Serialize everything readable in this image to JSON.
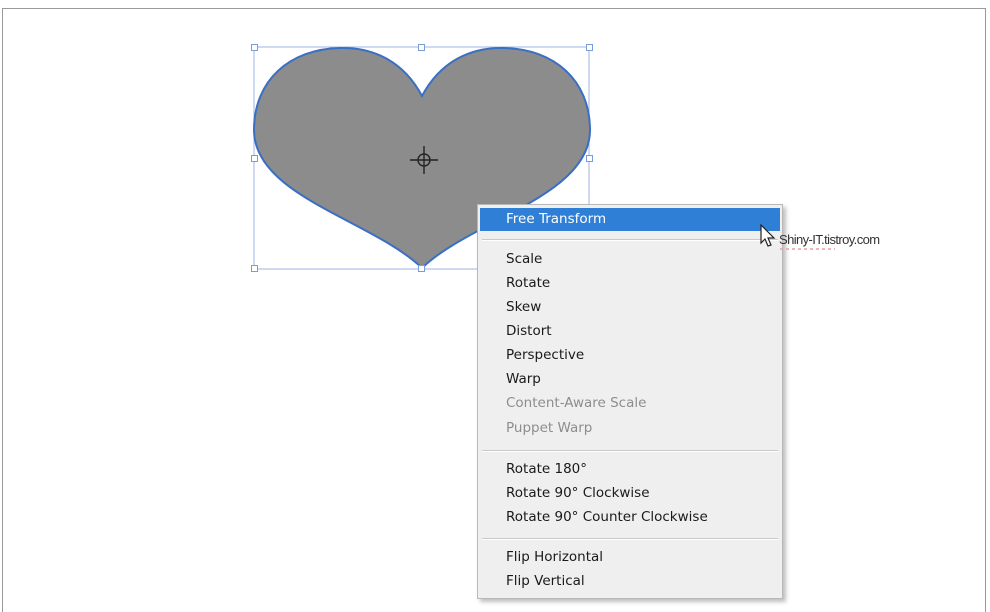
{
  "colors": {
    "heart_fill": "#8c8c8c",
    "heart_stroke": "#3a6fc4",
    "selection": "#7a9cd8",
    "menu_highlight": "#2f7fd7",
    "menu_bg": "#efefef"
  },
  "canvas": {
    "shape_name": "heart",
    "transform_center_icon": "crosshair-target-icon"
  },
  "context_menu": {
    "items": [
      {
        "label": "Free Transform",
        "state": "highlighted"
      },
      {
        "label": "Scale",
        "state": "enabled"
      },
      {
        "label": "Rotate",
        "state": "enabled"
      },
      {
        "label": "Skew",
        "state": "enabled"
      },
      {
        "label": "Distort",
        "state": "enabled"
      },
      {
        "label": "Perspective",
        "state": "enabled"
      },
      {
        "label": "Warp",
        "state": "enabled"
      },
      {
        "label": "Content-Aware Scale",
        "state": "disabled"
      },
      {
        "label": "Puppet Warp",
        "state": "disabled"
      },
      {
        "label": "Rotate 180°",
        "state": "enabled"
      },
      {
        "label": "Rotate 90° Clockwise",
        "state": "enabled"
      },
      {
        "label": "Rotate 90° Counter Clockwise",
        "state": "enabled"
      },
      {
        "label": "Flip Horizontal",
        "state": "enabled"
      },
      {
        "label": "Flip Vertical",
        "state": "enabled"
      }
    ]
  },
  "watermark": {
    "text": "Shiny-IT.tistroy.com"
  },
  "cursor": {
    "icon": "arrow-cursor-icon"
  }
}
